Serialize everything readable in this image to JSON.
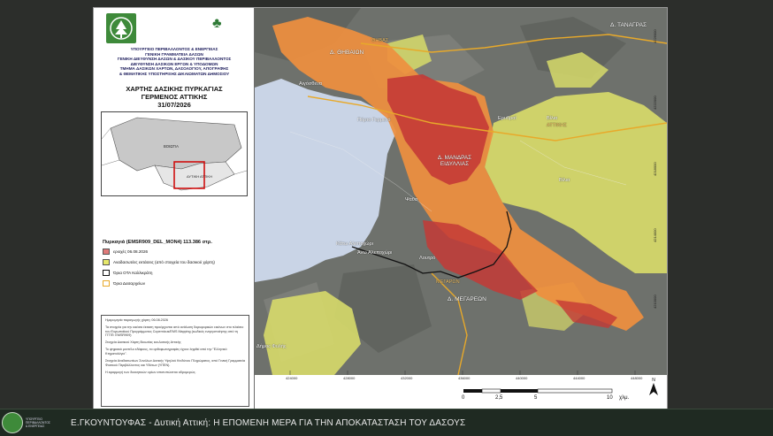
{
  "ministry_lines": [
    "ΥΠΟΥΡΓΕΙΟ ΠΕΡΙΒΑΛΛΟΝΤΟΣ & ΕΝΕΡΓΕΙΑΣ",
    "ΓΕΝΙΚΗ ΓΡΑΜΜΑΤΕΙΑ ΔΑΣΩΝ",
    "ΓΕΝΙΚΗ ΔΙΕΥΘΥΝΣΗ ΔΑΣΩΝ & ΔΑΣΙΚΟΥ ΠΕΡΙΒΑΛΛΟΝΤΟΣ",
    "ΔΙΕΥΘΥΝΣΗ ΔΑΣΙΚΩΝ ΕΡΓΩΝ & ΥΠΟΔΟΜΩΝ",
    "ΤΜΗΜΑ ΔΑΣΙΚΩΝ ΧΑΡΤΩΝ, ΔΑΣΟΛΟΓΙΟΥ, ΑΠΟΓΡΑΦΗΣ",
    "& ΘΕΜΑΤΙΚΗΣ ΥΠΟΣΤΗΡΙΞΗΣ ΔΙΚΑΙΩΜΑΤΩΝ ΔΗΜΟΣΙΟΥ"
  ],
  "title_lines": [
    "ΧΑΡΤΗΣ ΔΑΣΙΚΗΣ ΠΥΡΚΑΓΙΑΣ",
    "ΓΕΡΜΕΝΟΣ ΑΤΤΙΚΗΣ",
    "31/07/2026"
  ],
  "inset": {
    "label_north": "ΒΟΙΩΤΙΑ",
    "label_south": "ΔΥΤΙΚΗ ΑΤΤΙΚΗ"
  },
  "legend": {
    "heading": "Πυρκαγιά (EMSR909_DEL_MON4)  113.386 στρ.",
    "items": [
      {
        "label": "εριοχές 06.08.2026",
        "color": "#e07a7a"
      },
      {
        "label": "Αναδασωτέες εκτάσεις (από στοιχεία του δασικού χάρτη)",
        "color": "#e6e86a"
      },
      {
        "label": "Όρια ΟΤΑ Καλλικράτη",
        "color": "#ffffff"
      },
      {
        "label": "Όρια Δασαρχείων",
        "color": "#ffffff"
      }
    ],
    "line_colors": {
      "ota": "#111111",
      "forestry": "#e8a92a"
    }
  },
  "notes": [
    "Ημερομηνία παραγωγής χάρτη: 06.08.2026",
    "Τα στοιχεία για την καέισα έκταση προέρχονται από ανάλυση δορυφορικών εικόνων στο πλαίσιο του Ευρωπαϊκού Προγράμματος Copernicus/EMS Mapping (κωδικός ενεργοποίησης από τη ΓΓΠΠ: EMSR909)",
    "Στοιχεία Δασικού Χάρτη Βοιωτίας και Δυτικής Αττικής",
    "Το ψηφιακό μοντέλο εδάφους, τα ορθοφωτογραφίες έχουν ληφθεί από την \"Ελληνικό Κτηματολόγιο\".",
    "Στοιχεία Αναδασωτέων Συνόλων Δυτικής Υψηλού Κινδύνου Πληρώματος, από Γενική Γραμματεία Φυσικού Περιβάλλοντος και Υδάτων (ΥΠΕΝ).",
    "Η εφαρμογή των διοικητικών ορίων αποτυπώνεται αδρομερώς."
  ],
  "map_labels": [
    {
      "text": "Δ. ΘΗΒΑΙΩΝ",
      "kind": "city"
    },
    {
      "text": "Δ. ΤΑΝΑΓΡΑΣ",
      "kind": "city"
    },
    {
      "text": "ΘΗΒΑΣ",
      "kind": "forestry"
    },
    {
      "text": "Δ. ΜΑΝΔΡΑΣ ΕΙΔΥΛΛΙΑΣ",
      "kind": "city"
    },
    {
      "text": "Δ. ΜΕΓΑΡΕΩΝ",
      "kind": "city"
    },
    {
      "text": "ΜΕΓΑΡΩΝ",
      "kind": "forestry"
    },
    {
      "text": "ΑΤΤΙΚΗΣ",
      "kind": "forestry"
    },
    {
      "text": "Αιγόσθενα",
      "kind": "place"
    },
    {
      "text": "Πόρτο Γερμενό",
      "kind": "place"
    },
    {
      "text": "Βίλια",
      "kind": "place"
    },
    {
      "text": "Ερυθραί",
      "kind": "place"
    },
    {
      "text": "Κάτω Αλεποχώρι",
      "kind": "place"
    },
    {
      "text": "Άνω Αλεποχώρι",
      "kind": "place"
    },
    {
      "text": "Ψάθα",
      "kind": "place"
    },
    {
      "text": "Λουτρό",
      "kind": "place"
    },
    {
      "text": "Βίλια",
      "kind": "place"
    },
    {
      "text": "Δήμος Φυλής",
      "kind": "place"
    }
  ],
  "grid_x_labels": [
    "424000",
    "428000",
    "432000",
    "436000",
    "440000",
    "444000",
    "448000"
  ],
  "grid_y_labels": [
    "4226000",
    "4222000",
    "4218000",
    "4214000",
    "4210000",
    "4206000"
  ],
  "scale_bar": {
    "ticks": [
      "0",
      "2,5",
      "5",
      "10"
    ],
    "unit": "χλμ."
  },
  "north_label": "N",
  "footer": {
    "caption": "Ε.ΓΚΟΥΝΤΟΥΦΑΣ - Δυτική Αττική: Η ΕΠΟΜΕΝΗ ΜΕΡΑ ΓΙΑ ΤΗΝ ΑΠΟΚΑΤΑΣΤΑΣΗ ΤΟΥ ΔΑΣΟΥΣ",
    "logo_text": [
      "ΥΠΟΥΡΓΕΙΟ",
      "ΠΕΡΙΒΑΛΛΟΝΤΟΣ",
      "& ΕΝΕΡΓΕΙΑΣ"
    ]
  }
}
